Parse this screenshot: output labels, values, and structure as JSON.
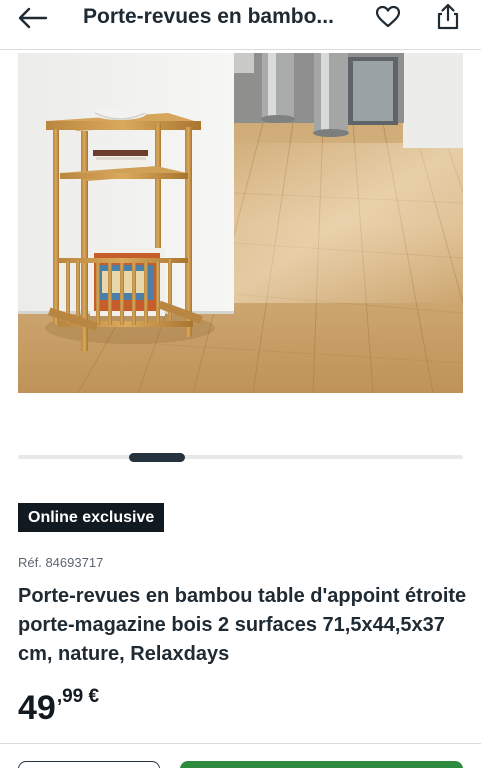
{
  "header": {
    "title": "Porte-revues en bambo...",
    "icons": {
      "back": "arrow-left-icon",
      "favorite": "heart-outline-icon",
      "share": "share-icon"
    }
  },
  "gallery": {
    "image_alt": "Porte-revues en bambou",
    "active_slide": 1,
    "slide_count": 4
  },
  "product": {
    "badge": "Online exclusive",
    "reference": "Réf. 84693717",
    "title": "Porte-revues en bambou table d'appoint étroite porte-magazine bois 2 surfaces 71,5x44,5x37 cm, nature, Relaxdays",
    "price_integer": "49",
    "price_decimal": ",99 €"
  },
  "colors": {
    "text": "#1f2a33",
    "badge_bg": "#121a21",
    "carousel_active": "#26323d",
    "primary_button": "#2e8a3e"
  }
}
